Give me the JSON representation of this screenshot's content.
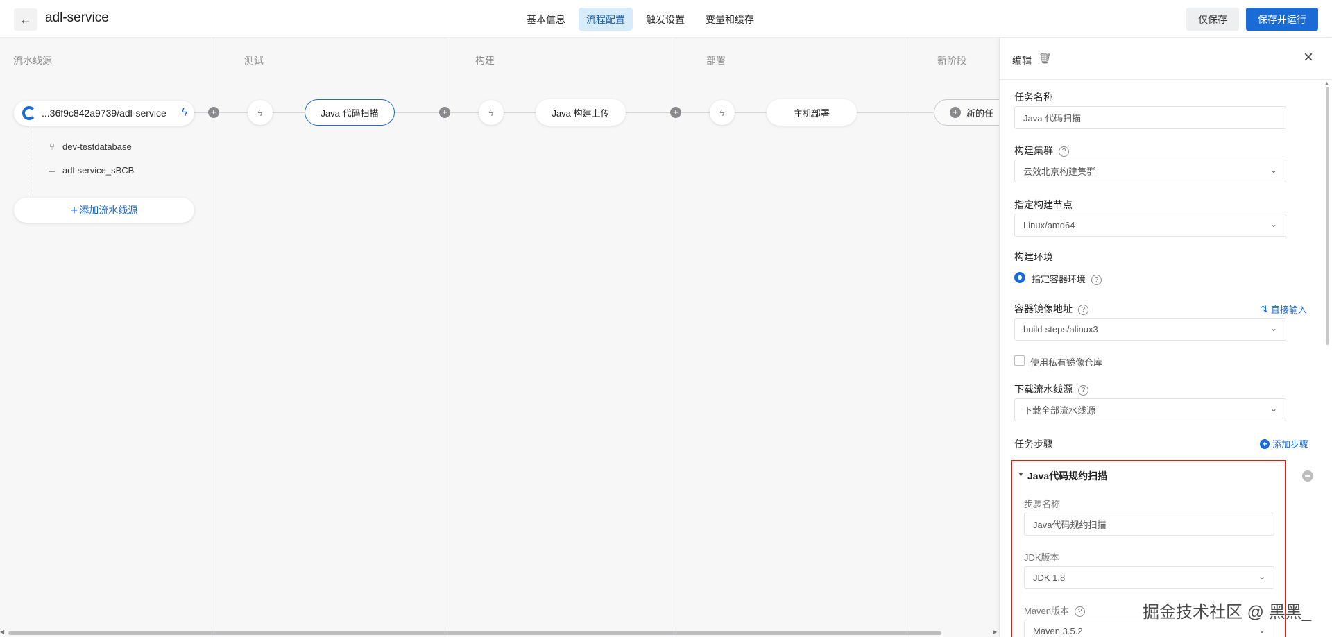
{
  "header": {
    "back_icon": "arrow-left-icon",
    "title": "adl-service",
    "tabs": [
      {
        "label": "基本信息",
        "active": false
      },
      {
        "label": "流程配置",
        "active": true
      },
      {
        "label": "触发设置",
        "active": false
      },
      {
        "label": "变量和缓存",
        "active": false
      }
    ],
    "save_only_label": "仅保存",
    "save_run_label": "保存并运行",
    "accent_color": "#1b6bd6"
  },
  "pipeline": {
    "columns": [
      {
        "title": "流水线源"
      },
      {
        "title": "测试"
      },
      {
        "title": "构建"
      },
      {
        "title": "部署"
      },
      {
        "title": "新阶段"
      }
    ],
    "source": {
      "repo_label": "...36f9c842a9739/adl-service",
      "branch": "dev-testdatabase",
      "folder": "adl-service_sBCB",
      "add_source_label": "添加流水线源"
    },
    "tasks": [
      {
        "label": "Java 代码扫描",
        "selected": true
      },
      {
        "label": "Java 构建上传",
        "selected": false
      },
      {
        "label": "主机部署",
        "selected": false
      }
    ],
    "new_task_label": "新的任"
  },
  "panel": {
    "title": "编辑",
    "task_name_label": "任务名称",
    "task_name_value": "Java 代码扫描",
    "cluster_label": "构建集群",
    "cluster_value": "云效北京构建集群",
    "node_label": "指定构建节点",
    "node_value": "Linux/amd64",
    "env_label": "构建环境",
    "env_option": "指定容器环境",
    "image_label": "容器镜像地址",
    "image_link": "直接输入",
    "image_value": "build-steps/alinux3",
    "private_repo_label": "使用私有镜像仓库",
    "download_label": "下载流水线源",
    "download_value": "下载全部流水线源",
    "steps_label": "任务步骤",
    "add_step_label": "添加步骤",
    "step": {
      "title": "Java代码规约扫描",
      "name_label": "步骤名称",
      "name_value": "Java代码规约扫描",
      "jdk_label": "JDK版本",
      "jdk_value": "JDK 1.8",
      "maven_label": "Maven版本",
      "maven_value": "Maven 3.5.2"
    }
  },
  "watermark": "掘金技术社区 @ 黑黑_"
}
